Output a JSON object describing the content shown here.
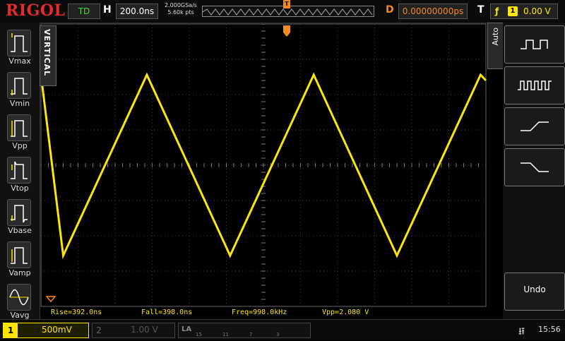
{
  "top": {
    "brand": "RIGOL",
    "run_status": "TD",
    "h_label": "H",
    "time_scale": "200.0ns",
    "sample_rate": "2.000GSa/s",
    "memory_depth": "5.60k pts",
    "d_label": "D",
    "delay": "0.00000000ps",
    "t_label": "T",
    "trigger_channel": "1",
    "trigger_level": "0.00 V",
    "colors": {
      "brand": "#e32b2b",
      "status": "#35d635",
      "orange": "#f58a1f",
      "ch1": "#ffe600"
    }
  },
  "left_panel": {
    "tab": "VERTICAL",
    "items": [
      {
        "label": "Vmax",
        "icon": "vmax-icon"
      },
      {
        "label": "Vmin",
        "icon": "vmin-icon"
      },
      {
        "label": "Vpp",
        "icon": "vpp-icon"
      },
      {
        "label": "Vtop",
        "icon": "vtop-icon"
      },
      {
        "label": "Vbase",
        "icon": "vbase-icon"
      },
      {
        "label": "Vamp",
        "icon": "vamp-icon"
      },
      {
        "label": "Vavg",
        "icon": "vavg-icon"
      }
    ]
  },
  "right_panel": {
    "tab": "Auto",
    "buttons": [
      {
        "icon": "period-pulse-icon"
      },
      {
        "icon": "multi-period-icon"
      },
      {
        "icon": "rising-edge-icon"
      },
      {
        "icon": "falling-edge-icon"
      }
    ],
    "undo_label": "Undo"
  },
  "measurements": {
    "rise": "Rise=392.0ns",
    "fall": "Fall=398.0ns",
    "freq": "Freq=998.0kHz",
    "vpp": "Vpp=2.080 V"
  },
  "bottom": {
    "ch1_num": "1",
    "ch1_scale": "500mV",
    "ch2_num": "2",
    "ch2_scale": "1.00 V",
    "la_label": "LA",
    "la_ticks": [
      "15",
      "11",
      "7",
      "3"
    ],
    "time": "15:56"
  },
  "waveform": {
    "type": "triangle",
    "vertices": [
      [
        0.0,
        0.32
      ],
      [
        0.05,
        -0.32
      ],
      [
        0.238,
        0.32
      ],
      [
        0.425,
        -0.32
      ],
      [
        0.613,
        0.32
      ],
      [
        0.8,
        -0.32
      ],
      [
        0.988,
        0.32
      ],
      [
        1.0,
        0.3
      ]
    ]
  }
}
